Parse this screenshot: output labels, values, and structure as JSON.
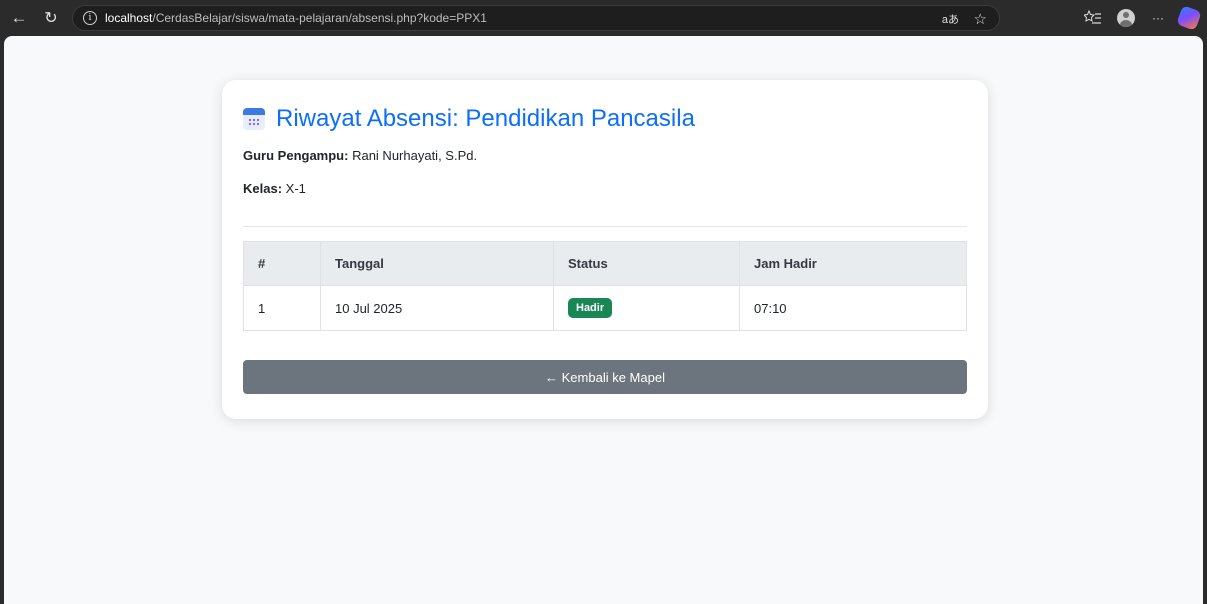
{
  "browser": {
    "back_glyph": "←",
    "refresh_glyph": "↻",
    "info_glyph": "i",
    "url_host": "localhost",
    "url_path": "/CerdasBelajar/siswa/mata-pelajaran/absensi.php?kode=PPX1",
    "read_aloud": "aあ",
    "favorites_glyph": "☆",
    "collections_glyph": "⭐",
    "more_glyph": "···"
  },
  "page": {
    "title": "Riwayat Absensi: Pendidikan Pancasila",
    "icon": "calendar-icon",
    "teacher_label": "Guru Pengampu:",
    "teacher_value": "Rani Nurhayati, S.Pd.",
    "class_label": "Kelas:",
    "class_value": "X-1"
  },
  "table": {
    "headers": [
      "#",
      "Tanggal",
      "Status",
      "Jam Hadir"
    ],
    "rows": [
      {
        "no": "1",
        "date": "10 Jul 2025",
        "status": "Hadir",
        "time": "07:10"
      }
    ]
  },
  "actions": {
    "back_label": "← Kembali ke Mapel"
  },
  "colors": {
    "title": "#0d6efd",
    "badge": "#198754",
    "button": "#6c757d"
  }
}
